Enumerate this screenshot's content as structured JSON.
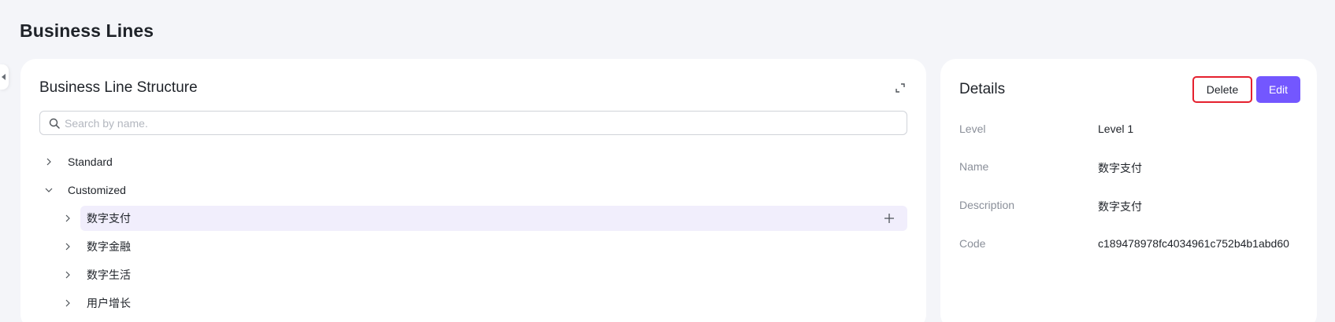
{
  "page": {
    "title": "Business Lines"
  },
  "structure": {
    "title": "Business Line Structure",
    "search_placeholder": "Search by name.",
    "tree": [
      {
        "label": "Standard",
        "expanded": false,
        "level": 0
      },
      {
        "label": "Customized",
        "expanded": true,
        "level": 0
      },
      {
        "label": "数字支付",
        "expanded": false,
        "level": 1,
        "selected": true
      },
      {
        "label": "数字金融",
        "expanded": false,
        "level": 1
      },
      {
        "label": "数字生活",
        "expanded": false,
        "level": 1
      },
      {
        "label": "用户增长",
        "expanded": false,
        "level": 1
      }
    ]
  },
  "details": {
    "title": "Details",
    "delete_label": "Delete",
    "edit_label": "Edit",
    "fields": [
      {
        "key": "Level",
        "value": "Level 1"
      },
      {
        "key": "Name",
        "value": "数字支付"
      },
      {
        "key": "Description",
        "value": "数字支付"
      },
      {
        "key": "Code",
        "value": "c189478978fc4034961c752b4b1abd60"
      }
    ]
  },
  "colors": {
    "accent": "#7357ff",
    "selected_row": "#f1eefc",
    "highlight_border": "#e5202e",
    "background": "#f4f5f9"
  }
}
